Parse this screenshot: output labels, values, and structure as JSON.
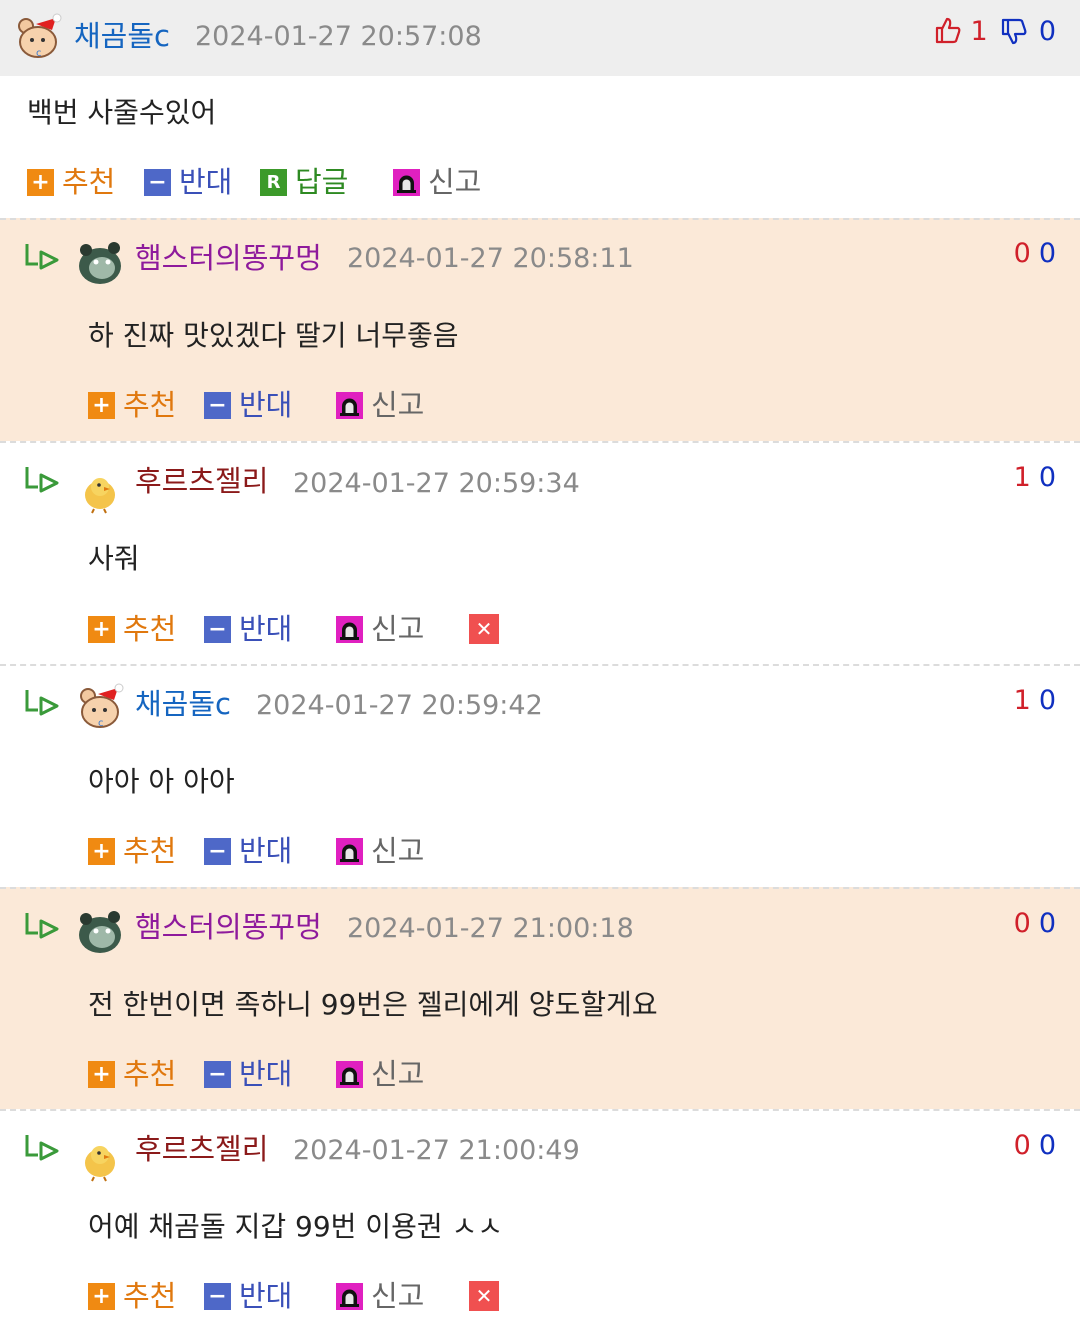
{
  "colors": {
    "recommend": "#f08a12",
    "oppose": "#4e68c8",
    "reply": "#3c9a2a",
    "report": "#e020c0",
    "delete": "#f05050",
    "nick_blue": "#1565c0",
    "nick_purple": "#8e1a9c",
    "nick_brown": "#8b1a1a",
    "highlight_bg": "#fbe9d8"
  },
  "labels": {
    "recommend": "추천",
    "oppose": "반대",
    "reply": "답글",
    "report": "신고"
  },
  "icons": {
    "recommend": "plus-square-icon",
    "oppose": "minus-square-icon",
    "reply": "r-square-icon",
    "report": "siren-icon",
    "delete": "close-icon",
    "thumbs_up": "thumbs-up-icon",
    "thumbs_down": "thumbs-down-icon",
    "reply_marker": "reply-arrow-icon"
  },
  "comments": [
    {
      "nick": "채곰돌c",
      "time": "2024-01-27 20:57:08",
      "text": "백번 사줄수있어",
      "up": "1",
      "down": "0",
      "avatar": "santa-bear-avatar"
    },
    {
      "nick": "햄스터의똥꾸멍",
      "time": "2024-01-27 20:58:11",
      "text": "하 진짜 맛있겠다 딸기 너무좋음",
      "up": "0",
      "down": "0",
      "avatar": "hamster-avatar"
    },
    {
      "nick": "후르츠젤리",
      "time": "2024-01-27 20:59:34",
      "text": "사줘",
      "up": "1",
      "down": "0",
      "avatar": "chick-avatar"
    },
    {
      "nick": "채곰돌c",
      "time": "2024-01-27 20:59:42",
      "text": "아아 아 아아",
      "up": "1",
      "down": "0",
      "avatar": "santa-bear-avatar"
    },
    {
      "nick": "햄스터의똥꾸멍",
      "time": "2024-01-27 21:00:18",
      "text": "전 한번이면 족하니 99번은 젤리에게 양도할게요",
      "up": "0",
      "down": "0",
      "avatar": "hamster-avatar"
    },
    {
      "nick": "후르츠젤리",
      "time": "2024-01-27 21:00:49",
      "text": "어예 채곰돌 지갑 99번 이용권 ㅅㅅ",
      "up": "0",
      "down": "0",
      "avatar": "chick-avatar"
    }
  ]
}
